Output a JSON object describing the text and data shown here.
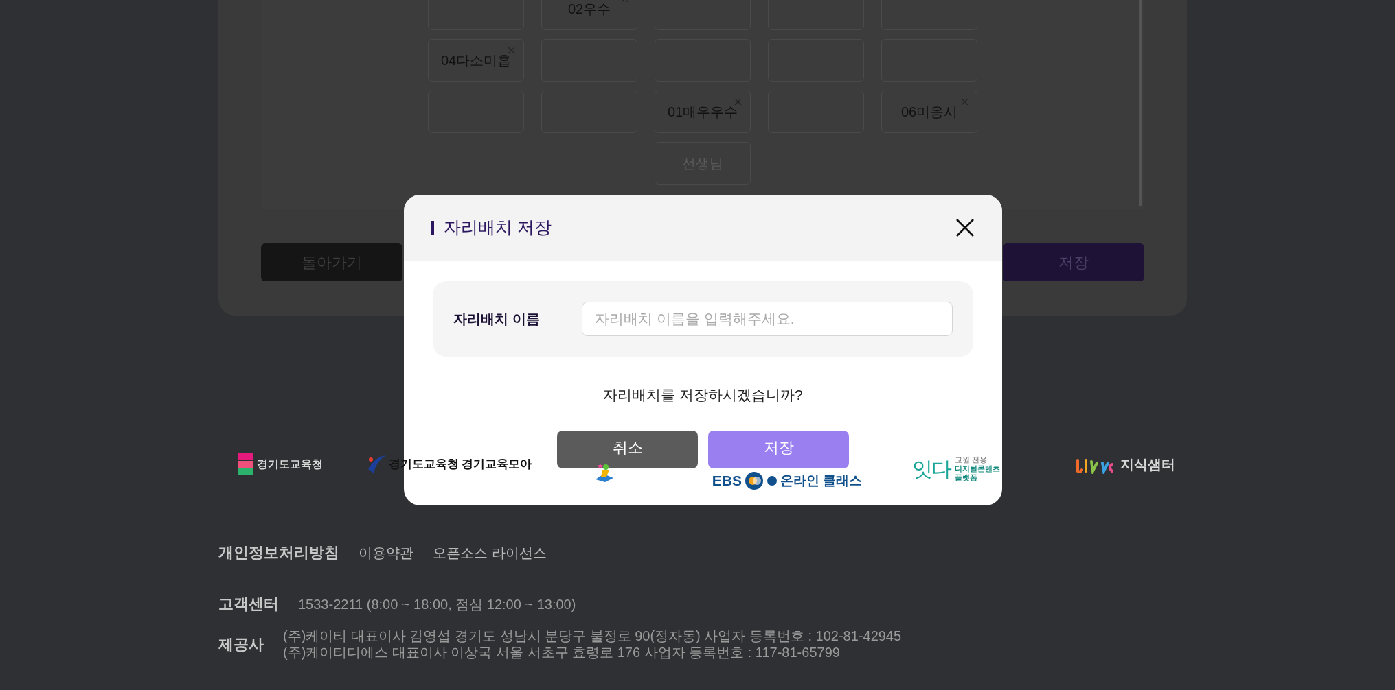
{
  "seat_grid": {
    "rows": [
      [
        {
          "kind": "empty"
        },
        {
          "kind": "student",
          "name": "02우수"
        },
        {
          "kind": "empty"
        },
        {
          "kind": "empty"
        },
        {
          "kind": "empty"
        }
      ],
      [
        {
          "kind": "student",
          "name": "04다소미흡"
        },
        {
          "kind": "empty"
        },
        {
          "kind": "empty"
        },
        {
          "kind": "empty"
        },
        {
          "kind": "empty"
        }
      ],
      [
        {
          "kind": "empty"
        },
        {
          "kind": "empty"
        },
        {
          "kind": "student",
          "name": "01매우우수"
        },
        {
          "kind": "empty"
        },
        {
          "kind": "student",
          "name": "06미응시"
        }
      ]
    ],
    "teacher": "선생님"
  },
  "page_buttons": [
    {
      "kind": "back",
      "label": "돌아가기"
    },
    {
      "kind": "primary",
      "label": "저장"
    }
  ],
  "dialog": {
    "title": "자리배치 저장",
    "field": {
      "label": "자리배치 이름",
      "placeholder": "자리배치 이름을 입력해주세요."
    },
    "message": "자리배치를 저장하시겠습니까?",
    "buttons": [
      {
        "kind": "cancel",
        "label": "취소"
      },
      {
        "kind": "confirm",
        "label": "저장"
      }
    ]
  },
  "partner_logos": [
    {
      "kind": "gyeonggi",
      "texts": [
        "경기도교육청"
      ]
    },
    {
      "kind": "moa",
      "texts": [
        "경기도교육청 경기교육모아"
      ]
    },
    {
      "kind": "ehak"
    },
    {
      "kind": "ebs",
      "texts": [
        "EBS",
        "온라인 클래스"
      ]
    },
    {
      "kind": "itda",
      "texts": [
        "잇다",
        "교원 전용",
        "디지털콘텐츠",
        "플랫폼"
      ]
    },
    {
      "kind": "jisik",
      "texts": [
        "지식샘터"
      ]
    }
  ],
  "footer": {
    "links": [
      "개인정보처리방침",
      "이용약관",
      "오픈소스 라이선스"
    ],
    "support": {
      "label": "고객센터",
      "text": "1533-2211 (8:00 ~ 18:00, 점심 12:00 ~ 13:00)"
    },
    "provider": {
      "label": "제공사",
      "lines": [
        "(주)케이티 대표이사 김영섭 경기도 성남시 분당구 불정로 90(정자동) 사업자 등록번호 : 102-81-42945",
        "(주)케이티디에스 대표이사 이상국 서울 서초구 효령로 176 사업자 등록번호 : 117-81-65799"
      ]
    }
  }
}
